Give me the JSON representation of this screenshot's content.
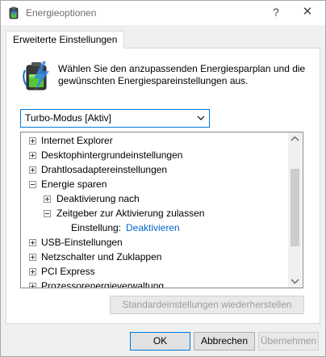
{
  "window": {
    "title": "Energieoptionen",
    "help_glyph": "?",
    "close_glyph": "✕"
  },
  "tab": {
    "label": "Erweiterte Einstellungen"
  },
  "description": "Wählen Sie den anzupassenden Energiesparplan und die gewünschten Energiespareinstellungen aus.",
  "plan_select": {
    "value": "Turbo-Modus [Aktiv]"
  },
  "tree": {
    "items": [
      {
        "label": "Internet Explorer",
        "expander": "plus"
      },
      {
        "label": "Desktophintergrundeinstellungen",
        "expander": "plus"
      },
      {
        "label": "Drahtlosadaptereinstellungen",
        "expander": "plus"
      },
      {
        "label": "Energie sparen",
        "expander": "minus"
      },
      {
        "label": "Deaktivierung nach",
        "expander": "plus"
      },
      {
        "label": "Zeitgeber zur Aktivierung zulassen",
        "expander": "minus"
      },
      {
        "label": "Einstellung:",
        "value": "Deaktivieren"
      },
      {
        "label": "USB-Einstellungen",
        "expander": "plus"
      },
      {
        "label": "Netzschalter und Zuklappen",
        "expander": "plus"
      },
      {
        "label": "PCI Express",
        "expander": "plus"
      },
      {
        "label": "Prozessorenergieverwaltung",
        "expander": "plus"
      }
    ]
  },
  "buttons": {
    "restore": "Standardeinstellungen wiederherstellen",
    "ok": "OK",
    "cancel": "Abbrechen",
    "apply": "Übernehmen"
  },
  "colors": {
    "accent": "#0078d7",
    "link": "#0066cc"
  }
}
